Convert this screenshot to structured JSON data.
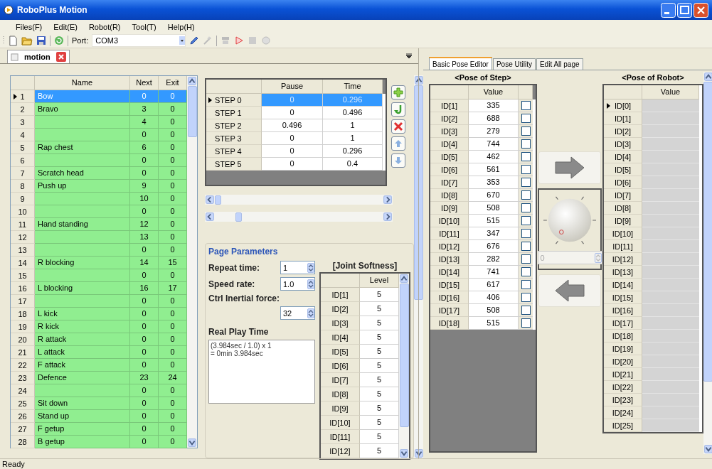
{
  "window": {
    "title": "RoboPlus Motion"
  },
  "menu": [
    "Files(F)",
    "Edit(E)",
    "Robot(R)",
    "Tool(T)",
    "Help(H)"
  ],
  "toolbar": {
    "port_label": "Port:",
    "port_value": "COM3"
  },
  "document_tab": {
    "label": "motion"
  },
  "motion_table": {
    "columns": [
      "Name",
      "Next",
      "Exit"
    ],
    "rows": [
      {
        "number": "1",
        "name": "Bow",
        "next": "0",
        "exit": "0",
        "selected": true
      },
      {
        "number": "2",
        "name": "Bravo",
        "next": "3",
        "exit": "0",
        "selected": false
      },
      {
        "number": "3",
        "name": "",
        "next": "4",
        "exit": "0",
        "selected": false
      },
      {
        "number": "4",
        "name": "",
        "next": "0",
        "exit": "0",
        "selected": false
      },
      {
        "number": "5",
        "name": "Rap chest",
        "next": "6",
        "exit": "0",
        "selected": false
      },
      {
        "number": "6",
        "name": "",
        "next": "0",
        "exit": "0",
        "selected": false
      },
      {
        "number": "7",
        "name": "Scratch head",
        "next": "0",
        "exit": "0",
        "selected": false
      },
      {
        "number": "8",
        "name": "Push up",
        "next": "9",
        "exit": "0",
        "selected": false
      },
      {
        "number": "9",
        "name": "",
        "next": "10",
        "exit": "0",
        "selected": false
      },
      {
        "number": "10",
        "name": "",
        "next": "0",
        "exit": "0",
        "selected": false
      },
      {
        "number": "11",
        "name": "Hand standing",
        "next": "12",
        "exit": "0",
        "selected": false
      },
      {
        "number": "12",
        "name": "",
        "next": "13",
        "exit": "0",
        "selected": false
      },
      {
        "number": "13",
        "name": "",
        "next": "0",
        "exit": "0",
        "selected": false
      },
      {
        "number": "14",
        "name": "R blocking",
        "next": "14",
        "exit": "15",
        "selected": false
      },
      {
        "number": "15",
        "name": "",
        "next": "0",
        "exit": "0",
        "selected": false
      },
      {
        "number": "16",
        "name": "L blocking",
        "next": "16",
        "exit": "17",
        "selected": false
      },
      {
        "number": "17",
        "name": "",
        "next": "0",
        "exit": "0",
        "selected": false
      },
      {
        "number": "18",
        "name": "L kick",
        "next": "0",
        "exit": "0",
        "selected": false
      },
      {
        "number": "19",
        "name": "R kick",
        "next": "0",
        "exit": "0",
        "selected": false
      },
      {
        "number": "20",
        "name": "R attack",
        "next": "0",
        "exit": "0",
        "selected": false
      },
      {
        "number": "21",
        "name": "L attack",
        "next": "0",
        "exit": "0",
        "selected": false
      },
      {
        "number": "22",
        "name": "F attack",
        "next": "0",
        "exit": "0",
        "selected": false
      },
      {
        "number": "23",
        "name": "Defence",
        "next": "23",
        "exit": "24",
        "selected": false
      },
      {
        "number": "24",
        "name": "",
        "next": "0",
        "exit": "0",
        "selected": false
      },
      {
        "number": "25",
        "name": "Sit down",
        "next": "0",
        "exit": "0",
        "selected": false
      },
      {
        "number": "26",
        "name": "Stand up",
        "next": "0",
        "exit": "0",
        "selected": false
      },
      {
        "number": "27",
        "name": "F getup",
        "next": "0",
        "exit": "0",
        "selected": false
      },
      {
        "number": "28",
        "name": "B getup",
        "next": "0",
        "exit": "0",
        "selected": false
      }
    ]
  },
  "step_table": {
    "columns": [
      "Pause",
      "Time"
    ],
    "rows": [
      {
        "label": "STEP 0",
        "pause": "0",
        "time": "0.296",
        "selected": true
      },
      {
        "label": "STEP 1",
        "pause": "0",
        "time": "0.496",
        "selected": false
      },
      {
        "label": "STEP 2",
        "pause": "0.496",
        "time": "1",
        "selected": false
      },
      {
        "label": "STEP 3",
        "pause": "0",
        "time": "1",
        "selected": false
      },
      {
        "label": "STEP 4",
        "pause": "0",
        "time": "0.296",
        "selected": false
      },
      {
        "label": "STEP 5",
        "pause": "0",
        "time": "0.4",
        "selected": false
      }
    ]
  },
  "page_parameters": {
    "title": "Page Parameters",
    "repeat_time": {
      "label": "Repeat time:",
      "value": "1"
    },
    "speed_rate": {
      "label": "Speed rate:",
      "value": "1.0"
    },
    "inertial_force": {
      "label": "Ctrl Inertial force:",
      "value": "32"
    },
    "real_play_time": {
      "label": "Real Play Time",
      "lines": [
        "(3.984sec / 1.0) x 1",
        "= 0min 3.984sec"
      ]
    }
  },
  "joint_softness": {
    "title": "[Joint Softness]",
    "column": "Level",
    "rows": [
      {
        "id": "ID[1]",
        "level": "5"
      },
      {
        "id": "ID[2]",
        "level": "5"
      },
      {
        "id": "ID[3]",
        "level": "5"
      },
      {
        "id": "ID[4]",
        "level": "5"
      },
      {
        "id": "ID[5]",
        "level": "5"
      },
      {
        "id": "ID[6]",
        "level": "5"
      },
      {
        "id": "ID[7]",
        "level": "5"
      },
      {
        "id": "ID[8]",
        "level": "5"
      },
      {
        "id": "ID[9]",
        "level": "5"
      },
      {
        "id": "ID[10]",
        "level": "5"
      },
      {
        "id": "ID[11]",
        "level": "5"
      },
      {
        "id": "ID[12]",
        "level": "5"
      }
    ]
  },
  "pose_tabs": [
    {
      "label": "Basic Pose Editor",
      "selected": true
    },
    {
      "label": "Pose Utility",
      "selected": false
    },
    {
      "label": "Edit All page",
      "selected": false
    }
  ],
  "pose_of_step": {
    "title": "<Pose of Step>",
    "column": "Value",
    "rows": [
      {
        "id": "ID[1]",
        "value": "335",
        "checked": false
      },
      {
        "id": "ID[2]",
        "value": "688",
        "checked": false
      },
      {
        "id": "ID[3]",
        "value": "279",
        "checked": false
      },
      {
        "id": "ID[4]",
        "value": "744",
        "checked": false
      },
      {
        "id": "ID[5]",
        "value": "462",
        "checked": false
      },
      {
        "id": "ID[6]",
        "value": "561",
        "checked": false
      },
      {
        "id": "ID[7]",
        "value": "353",
        "checked": false
      },
      {
        "id": "ID[8]",
        "value": "670",
        "checked": false
      },
      {
        "id": "ID[9]",
        "value": "508",
        "checked": false
      },
      {
        "id": "ID[10]",
        "value": "515",
        "checked": false
      },
      {
        "id": "ID[11]",
        "value": "347",
        "checked": false
      },
      {
        "id": "ID[12]",
        "value": "676",
        "checked": false
      },
      {
        "id": "ID[13]",
        "value": "282",
        "checked": false
      },
      {
        "id": "ID[14]",
        "value": "741",
        "checked": false
      },
      {
        "id": "ID[15]",
        "value": "617",
        "checked": false
      },
      {
        "id": "ID[16]",
        "value": "406",
        "checked": false
      },
      {
        "id": "ID[17]",
        "value": "508",
        "checked": false
      },
      {
        "id": "ID[18]",
        "value": "515",
        "checked": false
      }
    ]
  },
  "dial": {
    "value": "0",
    "disabled": true
  },
  "pose_of_robot": {
    "title": "<Pose of Robot>",
    "column": "Value",
    "rows": [
      {
        "id": "ID[0]",
        "selected": true
      },
      {
        "id": "ID[1]",
        "selected": false
      },
      {
        "id": "ID[2]",
        "selected": false
      },
      {
        "id": "ID[3]",
        "selected": false
      },
      {
        "id": "ID[4]",
        "selected": false
      },
      {
        "id": "ID[5]",
        "selected": false
      },
      {
        "id": "ID[6]",
        "selected": false
      },
      {
        "id": "ID[7]",
        "selected": false
      },
      {
        "id": "ID[8]",
        "selected": false
      },
      {
        "id": "ID[9]",
        "selected": false
      },
      {
        "id": "ID[10]",
        "selected": false
      },
      {
        "id": "ID[11]",
        "selected": false
      },
      {
        "id": "ID[12]",
        "selected": false
      },
      {
        "id": "ID[13]",
        "selected": false
      },
      {
        "id": "ID[14]",
        "selected": false
      },
      {
        "id": "ID[15]",
        "selected": false
      },
      {
        "id": "ID[16]",
        "selected": false
      },
      {
        "id": "ID[17]",
        "selected": false
      },
      {
        "id": "ID[18]",
        "selected": false
      },
      {
        "id": "ID[19]",
        "selected": false
      },
      {
        "id": "ID[20]",
        "selected": false
      },
      {
        "id": "ID[21]",
        "selected": false
      },
      {
        "id": "ID[22]",
        "selected": false
      },
      {
        "id": "ID[23]",
        "selected": false
      },
      {
        "id": "ID[24]",
        "selected": false
      },
      {
        "id": "ID[25]",
        "selected": false
      }
    ]
  },
  "status_bar": "Ready"
}
